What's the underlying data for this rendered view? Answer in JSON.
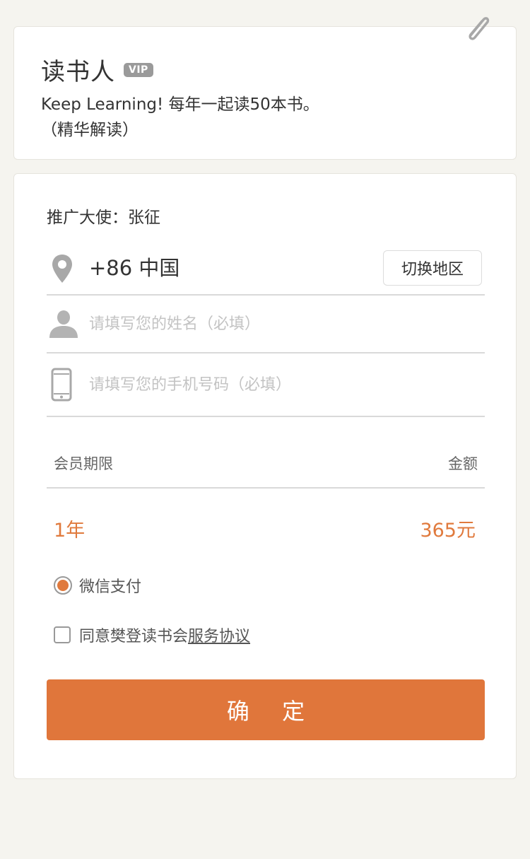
{
  "header": {
    "title": "读书人",
    "vip_badge": "VIP",
    "description_line1": "Keep Learning! 每年一起读50本书。",
    "description_line2": "（精华解读）",
    "attach_icon": "paperclip-icon"
  },
  "form": {
    "promoter": "推广大使：张征",
    "region": {
      "icon": "location-pin-icon",
      "text": "+86 中国",
      "switch_label": "切换地区"
    },
    "name_field": {
      "icon": "user-icon",
      "value": "",
      "placeholder": "请填写您的姓名（必填）"
    },
    "phone_field": {
      "icon": "phone-icon",
      "value": "",
      "placeholder": "请填写您的手机号码（必填）"
    },
    "membership": {
      "period_header": "会员期限",
      "amount_header": "金额",
      "period": "1年",
      "amount": "365元"
    },
    "payment": {
      "label": "微信支付",
      "selected": true
    },
    "agreement": {
      "prefix": "同意樊登读书会",
      "link": "服务协议",
      "checked": false
    },
    "confirm_label": "确 定"
  },
  "colors": {
    "accent": "#e0763b",
    "background": "#f5f4ef",
    "card": "#ffffff"
  }
}
